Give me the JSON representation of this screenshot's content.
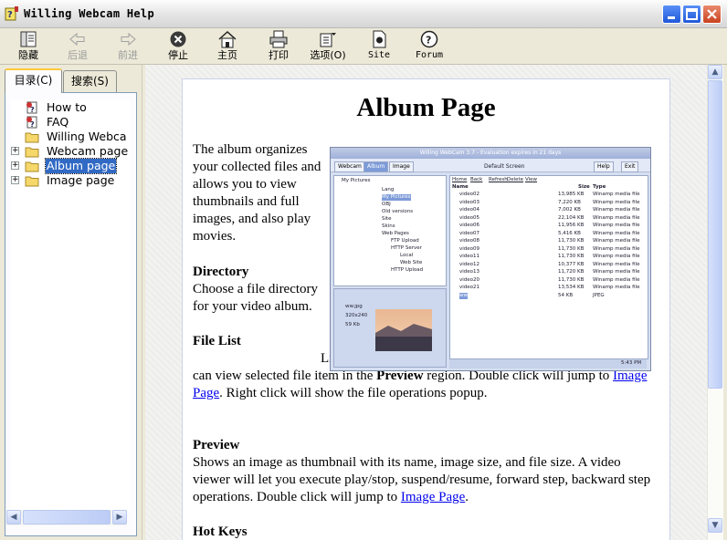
{
  "window": {
    "title": "Willing Webcam Help",
    "controls": [
      "minimize",
      "maximize",
      "close"
    ]
  },
  "toolbar": {
    "buttons": [
      {
        "label": "隐藏",
        "icon": "hide-panel-icon",
        "enabled": true
      },
      {
        "label": "后退",
        "icon": "back-arrow-icon",
        "enabled": false
      },
      {
        "label": "前进",
        "icon": "forward-arrow-icon",
        "enabled": false
      },
      {
        "label": "停止",
        "icon": "stop-icon",
        "enabled": true
      },
      {
        "label": "主页",
        "icon": "home-icon",
        "enabled": true
      },
      {
        "label": "打印",
        "icon": "print-icon",
        "enabled": true
      },
      {
        "label": "选项(O)",
        "icon": "options-icon",
        "enabled": true
      },
      {
        "label": "Site",
        "icon": "site-icon",
        "enabled": true
      },
      {
        "label": "Forum",
        "icon": "forum-icon",
        "enabled": true
      }
    ]
  },
  "nav": {
    "tabs": [
      {
        "label": "目录(C)",
        "active": true
      },
      {
        "label": "搜索(S)",
        "active": false
      }
    ],
    "tree": [
      {
        "label": "How to",
        "icon": "help-page-icon",
        "expandable": false,
        "selected": false
      },
      {
        "label": "FAQ",
        "icon": "help-page-icon",
        "expandable": false,
        "selected": false
      },
      {
        "label": "Willing Webca",
        "icon": "folder-icon",
        "expandable": false,
        "selected": false
      },
      {
        "label": "Webcam page",
        "icon": "folder-icon",
        "expandable": true,
        "selected": false
      },
      {
        "label": "Album page",
        "icon": "folder-icon",
        "expandable": true,
        "selected": true
      },
      {
        "label": "Image page",
        "icon": "folder-icon",
        "expandable": true,
        "selected": false
      }
    ]
  },
  "article": {
    "title": "Album Page",
    "intro": "The album organizes your collected files and allows you to view thumbnails and full images, and also play movies.",
    "sections": [
      {
        "heading": "Directory",
        "body": "Choose a file directory for your video album."
      },
      {
        "heading": "File List",
        "body_start": "Lists the images and video files in an album directory. You can view selected file item in the ",
        "body_bold": "Preview",
        "body_mid": " region. Double click will jump to ",
        "body_link": "Image Page",
        "body_end": ". Right click will show the file operations popup."
      },
      {
        "heading": "Preview",
        "body_start": "Shows an image as thumbnail with its name, image size, and file size. A video viewer will let you execute play/stop, suspend/resume, forward step, backward step operations. Double click will jump to ",
        "body_link": "Image Page",
        "body_end": "."
      },
      {
        "heading": "Hot Keys"
      }
    ]
  },
  "screenshot": {
    "title": "Willing WebCam 3.7 - Evaluation expires in 21 days",
    "tabs": [
      "Webcam",
      "Album",
      "Image"
    ],
    "active_tab": "Album",
    "screen_label": "Default Screen",
    "buttons": [
      "Help",
      "Exit"
    ],
    "folder": "My Pictures",
    "menu": [
      "Home",
      "Back",
      "Refresh",
      "Delete",
      "View"
    ],
    "tree": [
      "Lang",
      "My Pictures",
      "OBJ",
      "Old versions",
      "Site",
      "Skins",
      "Web Pages",
      "FTP Upload",
      "HTTP Server",
      "Local",
      "Web Site",
      "HTTP Upload"
    ],
    "columns": [
      "Name",
      "Size",
      "Type"
    ],
    "files": [
      {
        "name": "video02",
        "size": "13,985 KB",
        "type": "Winamp media file"
      },
      {
        "name": "video03",
        "size": "7,220 KB",
        "type": "Winamp media file"
      },
      {
        "name": "video04",
        "size": "7,002 KB",
        "type": "Winamp media file"
      },
      {
        "name": "video05",
        "size": "22,104 KB",
        "type": "Winamp media file"
      },
      {
        "name": "video06",
        "size": "11,956 KB",
        "type": "Winamp media file"
      },
      {
        "name": "video07",
        "size": "5,416 KB",
        "type": "Winamp media file"
      },
      {
        "name": "video08",
        "size": "11,730 KB",
        "type": "Winamp media file"
      },
      {
        "name": "video09",
        "size": "11,730 KB",
        "type": "Winamp media file"
      },
      {
        "name": "video11",
        "size": "11,730 KB",
        "type": "Winamp media file"
      },
      {
        "name": "video12",
        "size": "10,377 KB",
        "type": "Winamp media file"
      },
      {
        "name": "video13",
        "size": "11,720 KB",
        "type": "Winamp media file"
      },
      {
        "name": "video20",
        "size": "11,730 KB",
        "type": "Winamp media file"
      },
      {
        "name": "video21",
        "size": "13,534 KB",
        "type": "Winamp media file"
      },
      {
        "name": "ww",
        "size": "54 KB",
        "type": "JPEG"
      }
    ],
    "preview": {
      "name": "ww.jpg",
      "dims": "320x240",
      "size": "59 Kb"
    },
    "clock": "5:43 PM"
  }
}
